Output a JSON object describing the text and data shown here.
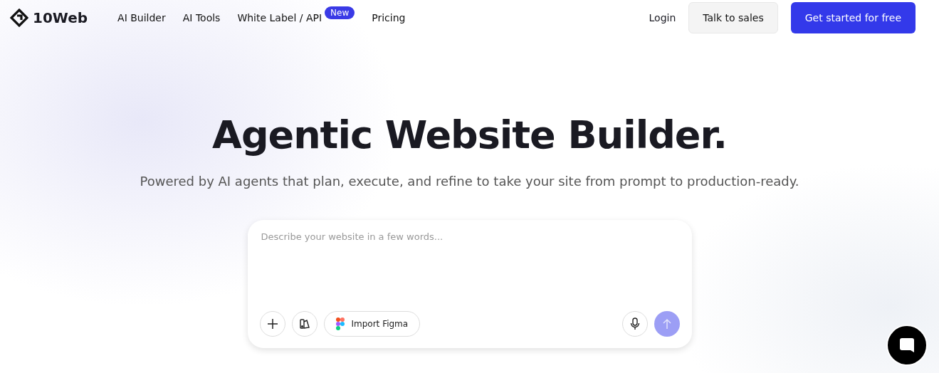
{
  "header": {
    "logo": "10Web",
    "nav": [
      {
        "label": "AI Builder"
      },
      {
        "label": "AI Tools"
      },
      {
        "label": "White Label / API",
        "badge": "New"
      },
      {
        "label": "Pricing"
      }
    ],
    "login": "Login",
    "sales": "Talk to sales",
    "cta": "Get started for free"
  },
  "hero": {
    "title": "Agentic Website Builder.",
    "subtitle": "Powered by AI agents that plan, execute, and refine to take your site from prompt to production-ready."
  },
  "prompt": {
    "placeholder": "Describe your website in a few words...",
    "figma": "Import Figma",
    "send_disabled": true
  }
}
